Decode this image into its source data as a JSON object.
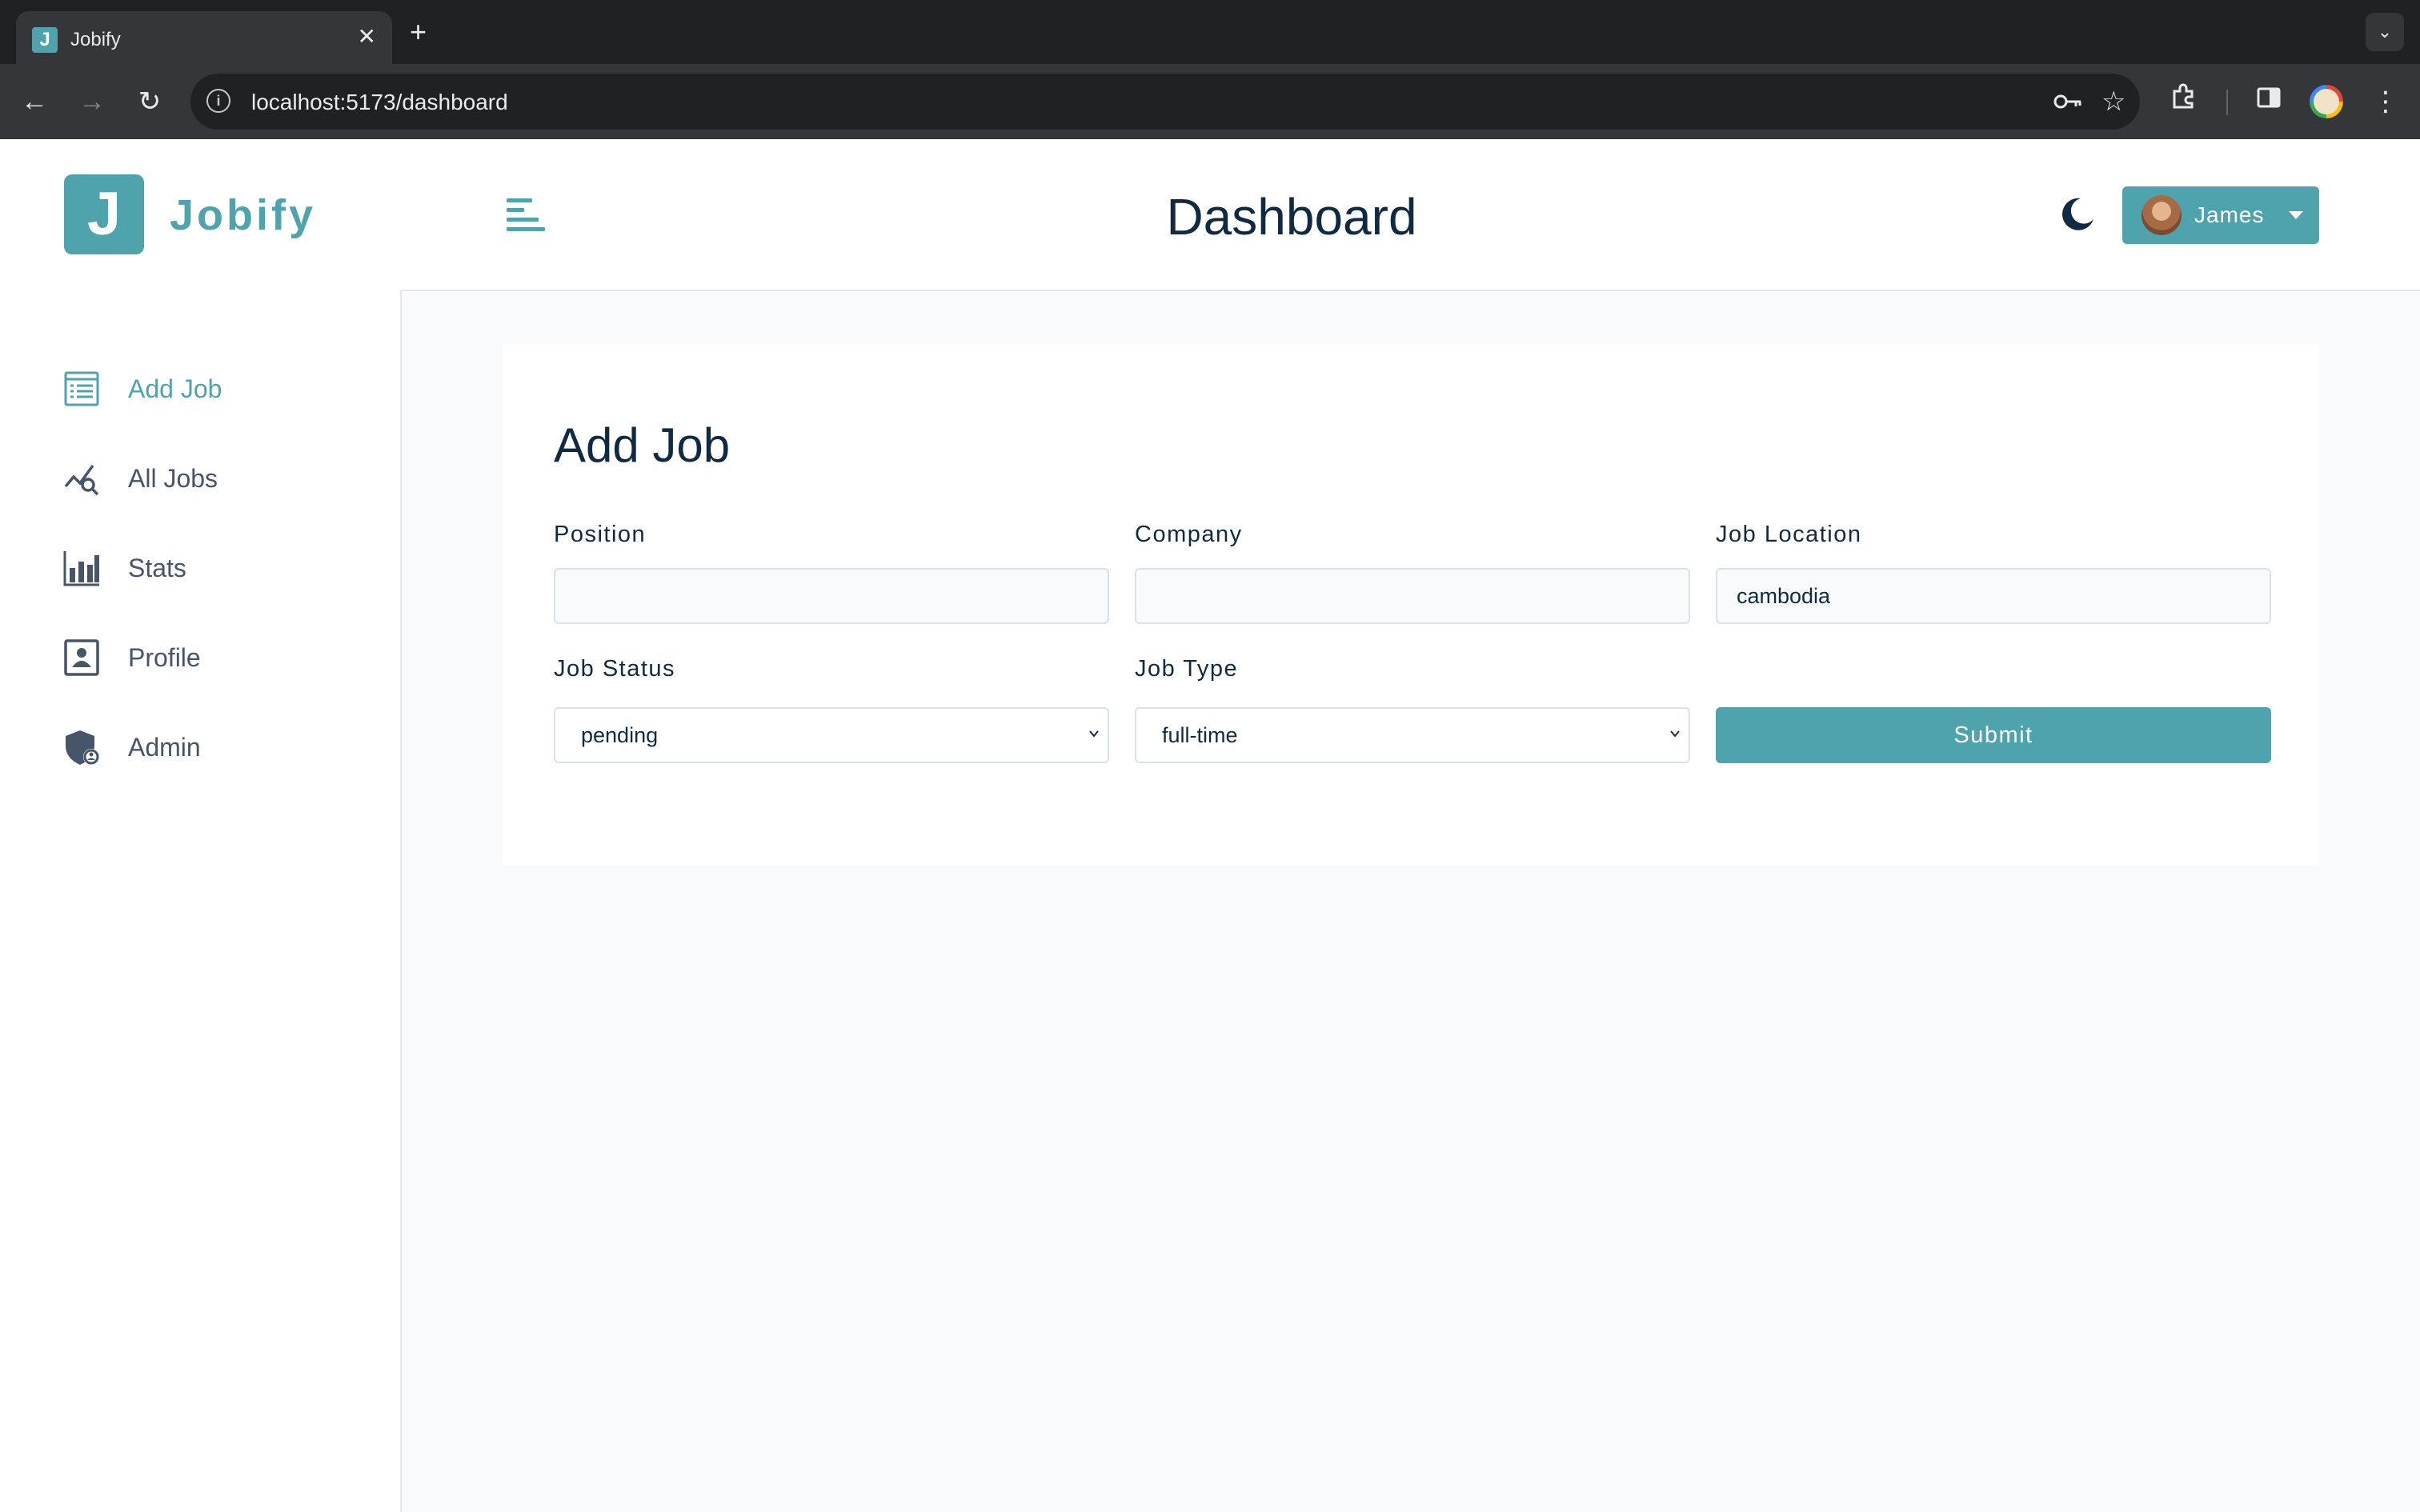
{
  "browser": {
    "tab_title": "Jobify",
    "tab_favicon_letter": "J",
    "url": "localhost:5173/dashboard",
    "icons": [
      "back-icon",
      "forward-icon",
      "reload-icon",
      "info-icon",
      "key-icon",
      "star-icon",
      "extensions-icon",
      "side-panel-icon",
      "profile-icon",
      "menu-icon",
      "close-icon",
      "new-tab-icon",
      "tab-search-icon"
    ]
  },
  "sidebar": {
    "logo_letter": "J",
    "logo_text": "Jobify",
    "items": [
      {
        "label": "Add Job",
        "icon": "add-job-icon",
        "active": true
      },
      {
        "label": "All Jobs",
        "icon": "all-jobs-icon",
        "active": false
      },
      {
        "label": "Stats",
        "icon": "stats-icon",
        "active": false
      },
      {
        "label": "Profile",
        "icon": "profile-icon",
        "active": false
      },
      {
        "label": "Admin",
        "icon": "admin-icon",
        "active": false
      }
    ]
  },
  "header": {
    "title": "Dashboard",
    "user_name": "James",
    "icons": [
      "menu-toggle-icon",
      "moon-icon",
      "caret-down-icon"
    ]
  },
  "form": {
    "title": "Add Job",
    "position_label": "Position",
    "position_value": "",
    "company_label": "Company",
    "company_value": "",
    "location_label": "Job Location",
    "location_value": "cambodia",
    "status_label": "Job Status",
    "status_value": "pending",
    "type_label": "Job Type",
    "type_value": "full-time",
    "submit_label": "Submit"
  },
  "colors": {
    "primary": "#4fa3ad",
    "text_dark": "#102a43",
    "nav_text": "#475569",
    "background": "#f8fafc"
  }
}
